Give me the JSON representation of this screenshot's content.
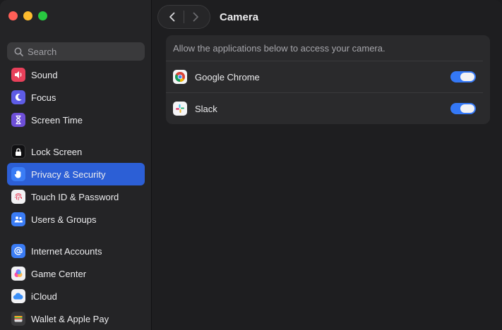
{
  "sidebar": {
    "search_placeholder": "Search",
    "groups": [
      [
        {
          "label": "Sound",
          "icon": "speaker-icon",
          "color": "#e8405a"
        },
        {
          "label": "Focus",
          "icon": "moon-icon",
          "color": "#5e5ce6"
        },
        {
          "label": "Screen Time",
          "icon": "hourglass-icon",
          "color": "#6e4fd8"
        }
      ],
      [
        {
          "label": "Lock Screen",
          "icon": "lock-icon",
          "color": "#1c1c1e"
        },
        {
          "label": "Privacy & Security",
          "icon": "hand-icon",
          "color": "#3a7cf5",
          "active": true
        },
        {
          "label": "Touch ID & Password",
          "icon": "fingerprint-icon",
          "color": "#f2f2f4"
        },
        {
          "label": "Users & Groups",
          "icon": "users-icon",
          "color": "#3a7cf5"
        }
      ],
      [
        {
          "label": "Internet Accounts",
          "icon": "at-icon",
          "color": "#3a7cf5"
        },
        {
          "label": "Game Center",
          "icon": "game-center-icon",
          "color": "#f2f2f4"
        },
        {
          "label": "iCloud",
          "icon": "cloud-icon",
          "color": "#f2f2f4"
        },
        {
          "label": "Wallet & Apple Pay",
          "icon": "wallet-icon",
          "color": "#3a3a3c"
        }
      ]
    ]
  },
  "header": {
    "title": "Camera"
  },
  "camera": {
    "description": "Allow the applications below to access your camera.",
    "apps": [
      {
        "name": "Google Chrome",
        "icon": "chrome-icon",
        "enabled": true
      },
      {
        "name": "Slack",
        "icon": "slack-icon",
        "enabled": true
      }
    ]
  },
  "colors": {
    "accent": "#2c5fd6",
    "toggle_on": "#3478f6"
  }
}
